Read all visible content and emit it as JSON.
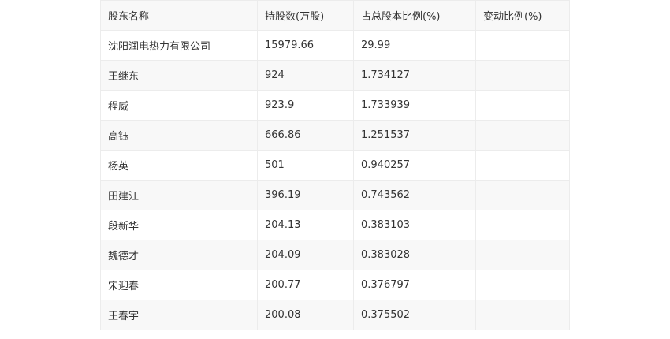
{
  "table": {
    "headers": [
      "股东名称",
      "持股数(万股)",
      "占总股本比例(%)",
      "变动比例(%)"
    ],
    "rows": [
      [
        "沈阳润电热力有限公司",
        "15979.66",
        "29.99",
        ""
      ],
      [
        "王继东",
        "924",
        "1.734127",
        ""
      ],
      [
        "程威",
        "923.9",
        "1.733939",
        ""
      ],
      [
        "高钰",
        "666.86",
        "1.251537",
        ""
      ],
      [
        "杨英",
        "501",
        "0.940257",
        ""
      ],
      [
        "田建江",
        "396.19",
        "0.743562",
        ""
      ],
      [
        "段新华",
        "204.13",
        "0.383103",
        ""
      ],
      [
        "魏德才",
        "204.09",
        "0.383028",
        ""
      ],
      [
        "宋迎春",
        "200.77",
        "0.376797",
        ""
      ],
      [
        "王春宇",
        "200.08",
        "0.375502",
        ""
      ]
    ]
  }
}
